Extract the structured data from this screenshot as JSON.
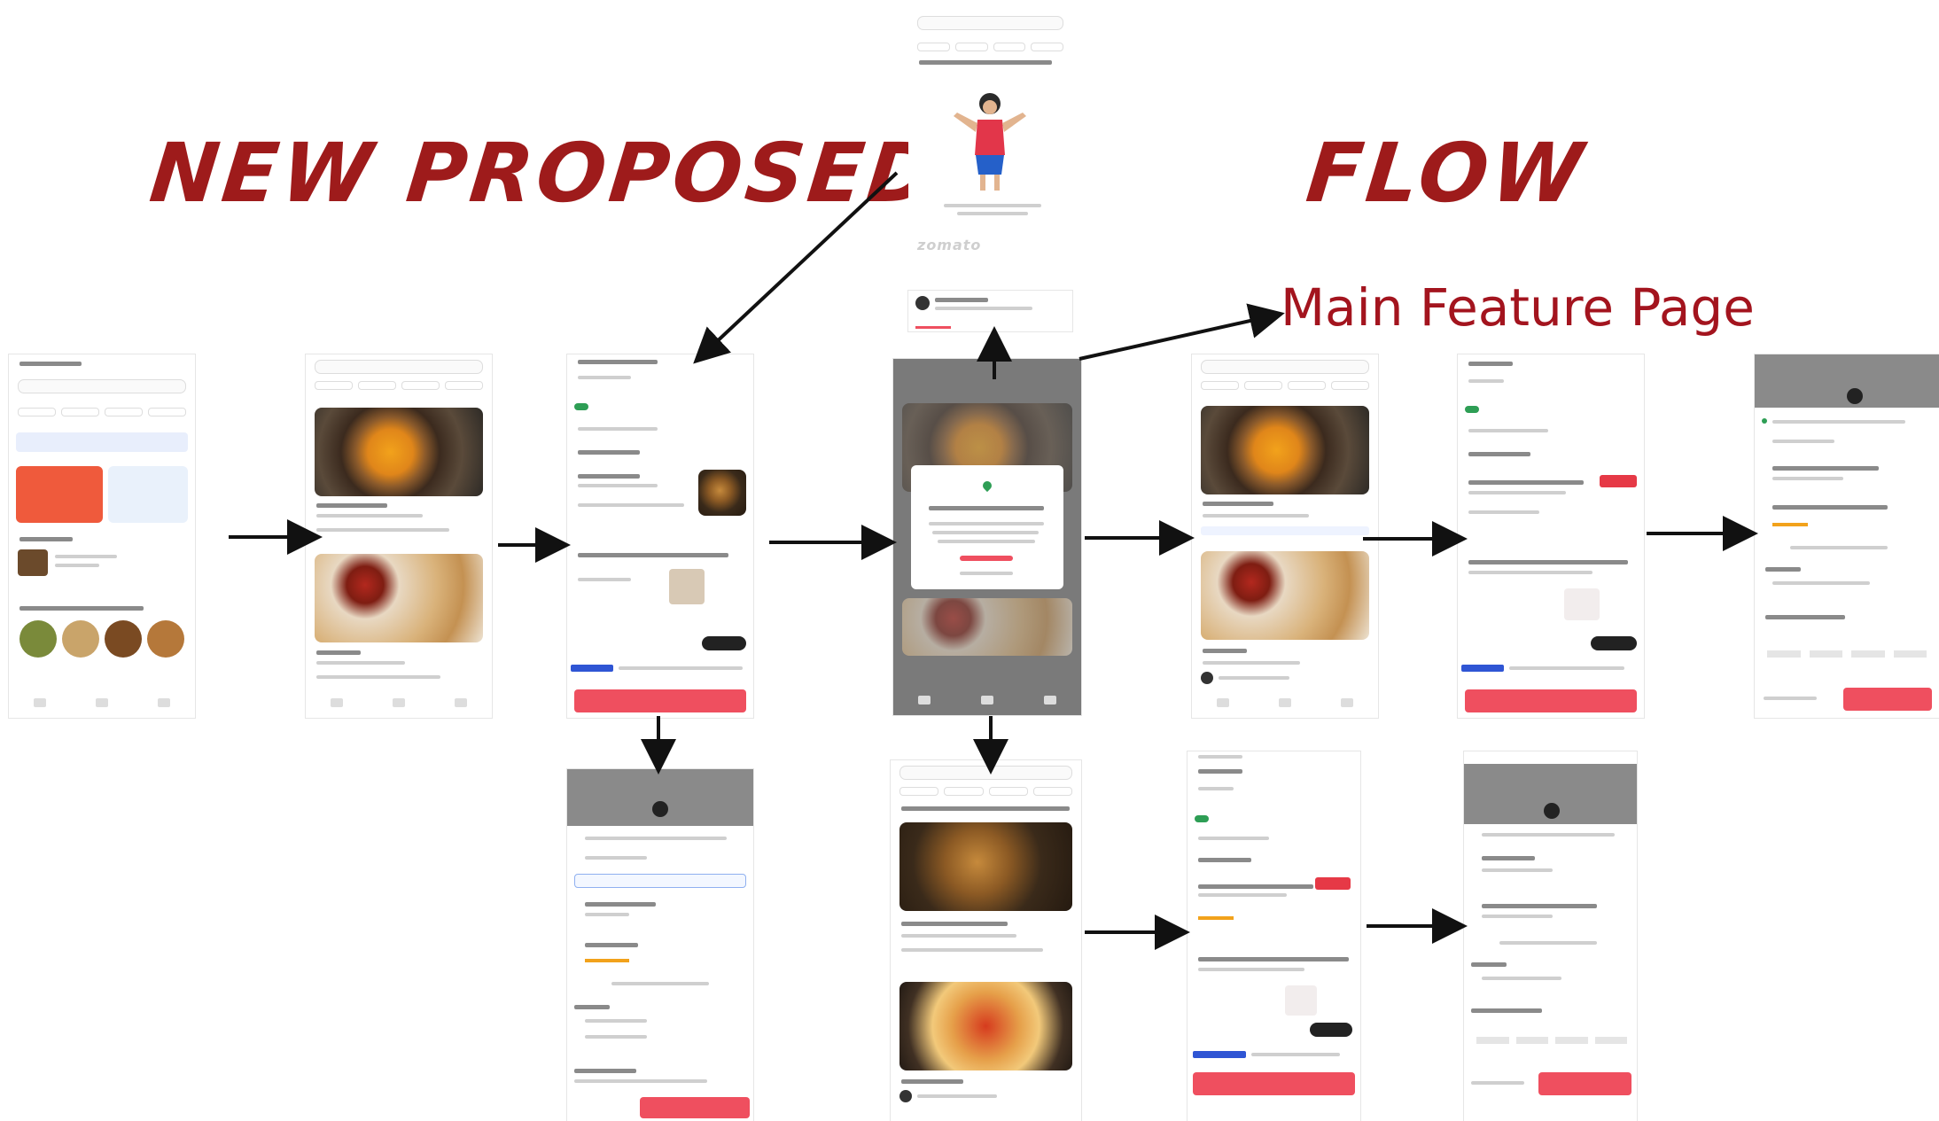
{
  "headline": {
    "left": "NEW PROPOSED",
    "right": "FLOW"
  },
  "subheading": "Main Feature Page",
  "watermark_logo": "zomato",
  "colors": {
    "headline": "#9e1b1b",
    "subheading": "#a3141e",
    "accent_red": "#ef4f5f",
    "arrow": "#111111"
  },
  "screens": [
    {
      "name": "home-screen"
    },
    {
      "name": "search-results-screen"
    },
    {
      "name": "restaurant-menu-screen"
    },
    {
      "name": "empty-state-screen"
    },
    {
      "name": "location-popup-screen"
    },
    {
      "name": "main-feature-screen"
    },
    {
      "name": "rolls-king-menu-screen"
    },
    {
      "name": "checkout-screen"
    },
    {
      "name": "hotel-cart-screen"
    },
    {
      "name": "nearby-restaurants-screen"
    },
    {
      "name": "rolls-king-menu-variant-screen"
    },
    {
      "name": "rolls-king-checkout-variant-screen"
    }
  ]
}
